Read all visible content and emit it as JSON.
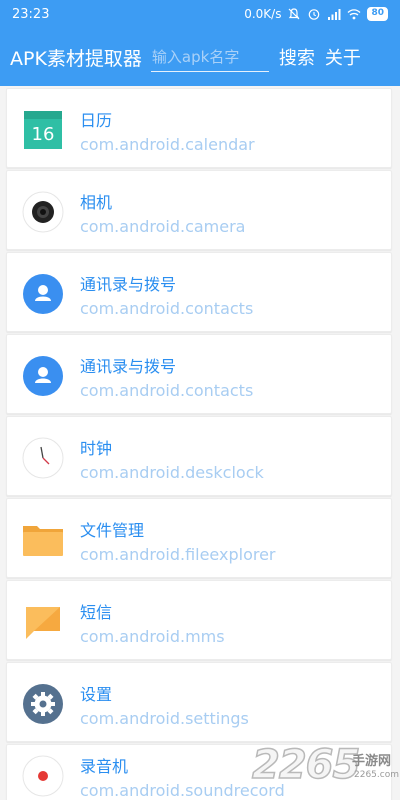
{
  "status_bar": {
    "time": "23:23",
    "speed": "0.0K/s",
    "battery": "80",
    "icons": [
      "bell-off-icon",
      "alarm-icon",
      "signal-icon",
      "wifi-icon",
      "battery-icon"
    ]
  },
  "toolbar": {
    "title": "APK素材提取器",
    "search_placeholder": "输入apk名字",
    "search_value": "",
    "search_label": "搜索",
    "about_label": "关于"
  },
  "colors": {
    "appbar": "#3d9cf3",
    "app_name": "#2a8ef0",
    "package_name": "#a8cdf2"
  },
  "apps": [
    {
      "name": "日历",
      "package": "com.android.calendar",
      "icon": "calendar-icon",
      "icon_text": "16"
    },
    {
      "name": "相机",
      "package": "com.android.camera",
      "icon": "camera-icon"
    },
    {
      "name": "通讯录与拨号",
      "package": "com.android.contacts",
      "icon": "contacts-icon"
    },
    {
      "name": "通讯录与拨号",
      "package": "com.android.contacts",
      "icon": "contacts-icon"
    },
    {
      "name": "时钟",
      "package": "com.android.deskclock",
      "icon": "clock-icon"
    },
    {
      "name": "文件管理",
      "package": "com.android.fileexplorer",
      "icon": "folder-icon"
    },
    {
      "name": "短信",
      "package": "com.android.mms",
      "icon": "message-icon"
    },
    {
      "name": "设置",
      "package": "com.android.settings",
      "icon": "settings-gear-icon"
    },
    {
      "name": "录音机",
      "package": "com.android.soundrecord",
      "icon": "sound-recorder-icon"
    }
  ],
  "watermark": {
    "number": "2265",
    "text": "手游网",
    "url": "2265.com"
  }
}
